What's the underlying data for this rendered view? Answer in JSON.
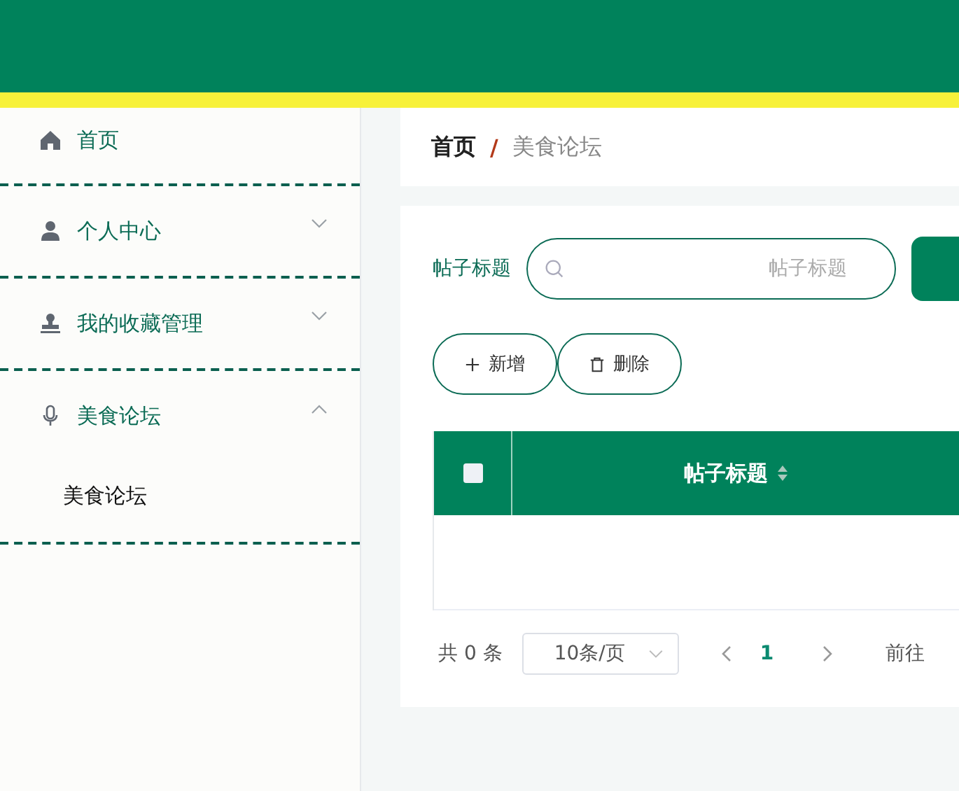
{
  "sidebar": {
    "items": [
      {
        "label": "首页"
      },
      {
        "label": "个人中心",
        "expanded": false
      },
      {
        "label": "我的收藏管理",
        "expanded": false
      },
      {
        "label": "美食论坛",
        "expanded": true,
        "children": [
          {
            "label": "美食论坛"
          }
        ]
      }
    ]
  },
  "breadcrumb": {
    "items": [
      "首页",
      "美食论坛"
    ],
    "separator": "/"
  },
  "search": {
    "label": "帖子标题",
    "placeholder": "帖子标题"
  },
  "buttons": [
    {
      "label": "新增"
    },
    {
      "label": "删除"
    }
  ],
  "table": {
    "select_all": {
      "checked": false
    },
    "columns": [
      {
        "label": "帖子标题",
        "sortable": true
      }
    ]
  },
  "pagination": {
    "total": "共 0 条",
    "page_size": "10条/页",
    "pages": [
      {
        "label": "1",
        "selected": true
      }
    ],
    "goto": "前往"
  }
}
